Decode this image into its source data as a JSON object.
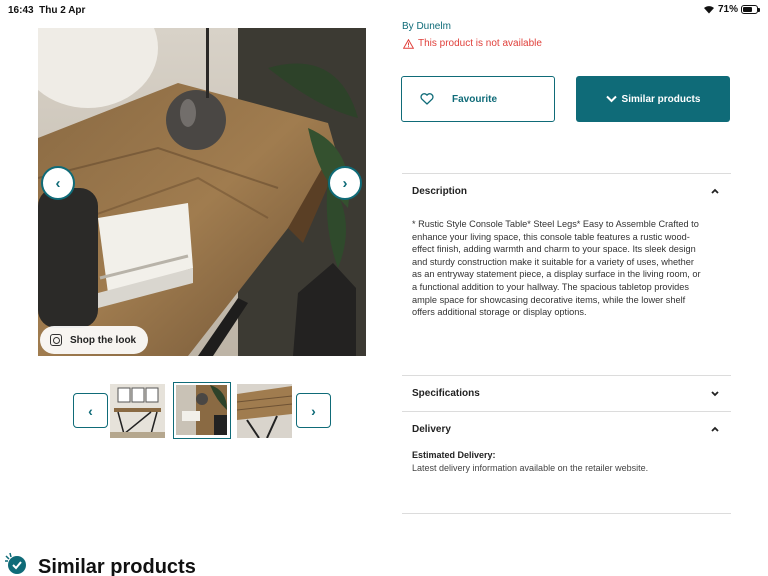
{
  "status_bar": {
    "time": "16:43",
    "date": "Thu 2 Apr",
    "battery": "71%",
    "battery_level": 0.71
  },
  "gallery": {
    "shop_look_label": "Shop the look",
    "prev_glyph": "‹",
    "next_glyph": "›",
    "thumbnail_count": 3,
    "selected_thumbnail": 2
  },
  "product": {
    "brand": "By Dunelm",
    "availability": "This product is not available",
    "favourite_label": "Favourite",
    "similar_label": "Similar products"
  },
  "accordion": {
    "description": {
      "title": "Description",
      "expanded": true,
      "text": "* Rustic Style Console Table* Steel Legs* Easy to Assemble Crafted to enhance your living space, this console table features a rustic wood-effect finish, adding warmth and charm to your space. Its sleek design and sturdy construction make it suitable for a variety of uses, whether as an entryway statement piece, a display surface in the living room, or a functional addition to your hallway. The spacious tabletop provides ample space for showcasing decorative items, while the lower shelf offers additional storage or display options."
    },
    "specifications": {
      "title": "Specifications",
      "expanded": false
    },
    "delivery": {
      "title": "Delivery",
      "expanded": true,
      "estimated_label": "Estimated Delivery:",
      "estimated_text": "Latest delivery information available on the retailer website."
    }
  },
  "similar_section": {
    "heading": "Similar products"
  },
  "colors": {
    "accent": "#0f6b78",
    "warning": "#e0403b"
  },
  "icons": [
    "wifi-icon",
    "battery-icon",
    "chevron-left-icon",
    "chevron-right-icon",
    "shop-look-icon",
    "warning-icon",
    "heart-icon",
    "chevron-down-icon",
    "chevron-up-icon",
    "similar-products-icon"
  ]
}
